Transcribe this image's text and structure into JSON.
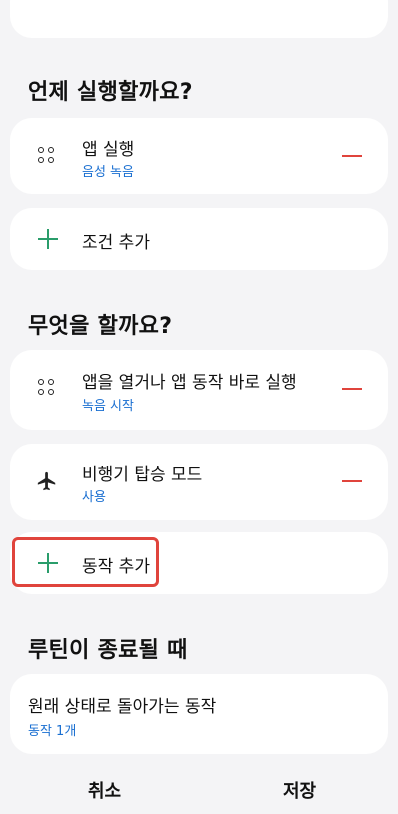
{
  "sections": {
    "when": {
      "title": "언제 실행할까요?"
    },
    "what": {
      "title": "무엇을 할까요?"
    },
    "end": {
      "title": "루틴이 종료될 때"
    }
  },
  "conditions": [
    {
      "title": "앱 실행",
      "subtitle": "음성 녹음",
      "icon": "apps-icon"
    }
  ],
  "add_condition_label": "조건 추가",
  "actions": [
    {
      "title": "앱을 열거나 앱 동작 바로 실행",
      "subtitle": "녹음 시작",
      "icon": "apps-icon"
    },
    {
      "title": "비행기 탑승 모드",
      "subtitle": "사용",
      "icon": "airplane-icon"
    }
  ],
  "add_action_label": "동작 추가",
  "end_card": {
    "title": "원래 상태로 돌아가는 동작",
    "subtitle": "동작 1개"
  },
  "footer": {
    "cancel_label": "취소",
    "save_label": "저장"
  },
  "colors": {
    "accent_blue": "#1a6fd1",
    "remove_red": "#e0443c",
    "add_green": "#2a9d6b",
    "highlight_red": "#e0443c"
  }
}
